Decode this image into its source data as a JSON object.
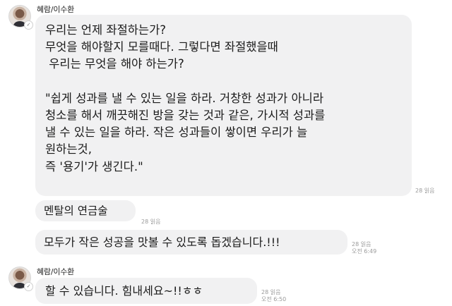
{
  "messages": [
    {
      "sender": "혜람/이수환",
      "lines": [
        "우리는 언제 좌절하는가?",
        "무엇을 해야할지 모를때다. 그렇다면 좌절했을때",
        " 우리는 무엇을 해야 하는가?",
        "",
        "\"쉽게 성과를 낼 수 있는 일을 하라. 거창한 성과가 아니라",
        "청소를 해서 깨끗해진 방을 갖는 것과 같은, 가시적 성과를",
        "낼 수 있는 일을 하라. 작은 성과들이 쌓이면 우리가 늘",
        "원하는것,",
        "즉 '용기'가 생긴다.\""
      ],
      "read": "28 읽음"
    },
    {
      "lines": [
        "멘탈의 연금술"
      ],
      "read": "28 읽음"
    },
    {
      "lines": [
        "모두가 작은 성공을 맛볼 수 있도록 돕겠습니다.!!!"
      ],
      "read": "28 읽음",
      "time": "오전 6:49"
    },
    {
      "sender": "혜람/이수환",
      "lines": [
        "할 수 있습니다. 힘내세요~!!ㅎㅎ"
      ],
      "read": "28 읽음",
      "time": "오전 6:50"
    }
  ]
}
